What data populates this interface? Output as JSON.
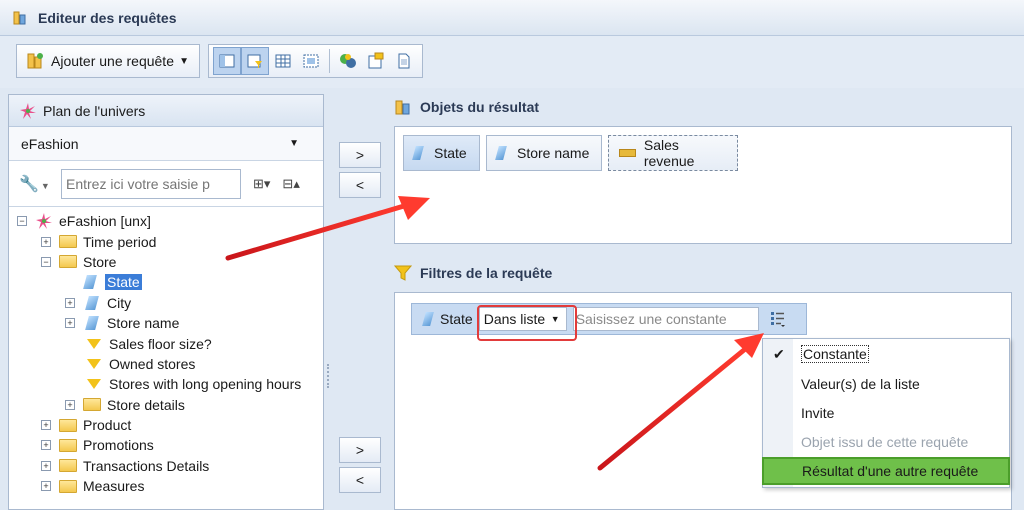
{
  "window": {
    "title": "Editeur des requêtes"
  },
  "toolbar": {
    "add_query_label": "Ajouter une requête"
  },
  "left_panel": {
    "title": "Plan de l'univers",
    "universe": "eFashion",
    "search_placeholder": "Entrez ici votre saisie p",
    "tree": {
      "root": "eFashion [unx]",
      "items": [
        {
          "label": "Time period"
        },
        {
          "label": "Store"
        },
        {
          "label": "State"
        },
        {
          "label": "City"
        },
        {
          "label": "Store name"
        },
        {
          "label": "Sales floor size?"
        },
        {
          "label": "Owned stores"
        },
        {
          "label": "Stores with long opening hours"
        },
        {
          "label": "Store details"
        },
        {
          "label": "Product"
        },
        {
          "label": "Promotions"
        },
        {
          "label": "Transactions Details"
        },
        {
          "label": "Measures"
        }
      ]
    }
  },
  "transfer_buttons": {
    "add": ">",
    "remove": "<"
  },
  "result_objects": {
    "title": "Objets du résultat",
    "chips": [
      "State",
      "Store name",
      "Sales revenue"
    ]
  },
  "query_filters": {
    "title": "Filtres de la requête",
    "filter": {
      "object": "State",
      "operator": "Dans liste",
      "constant_placeholder": "Saisissez une constante"
    }
  },
  "operand_menu": {
    "items": [
      {
        "label": "Constante",
        "checked": true,
        "enabled": true
      },
      {
        "label": "Valeur(s) de la liste",
        "enabled": true
      },
      {
        "label": "Invite",
        "enabled": true
      },
      {
        "label": "Objet issu de cette requête",
        "enabled": false
      },
      {
        "label": "Résultat d'une autre requête",
        "enabled": true,
        "highlighted": true
      }
    ]
  },
  "colors": {
    "annotation_arrow": "#e8201f",
    "highlight": "#6fc04a",
    "selection": "#3b7dd8"
  }
}
